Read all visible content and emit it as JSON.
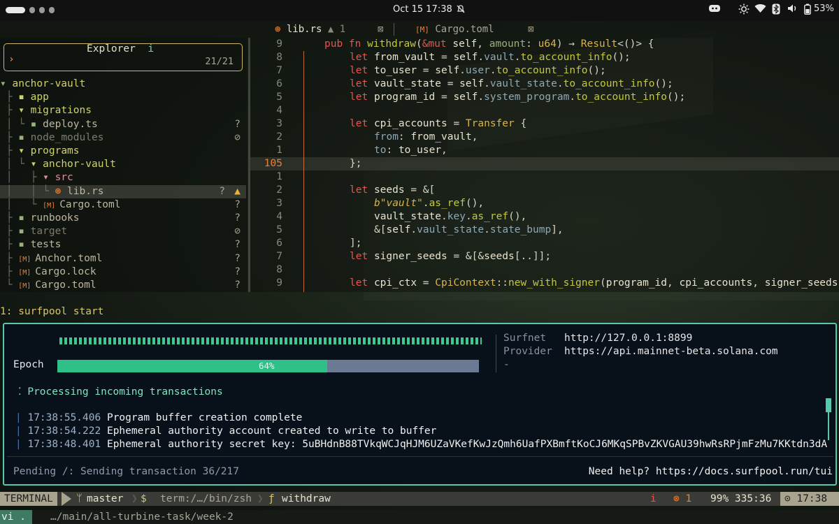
{
  "topbar": {
    "datetime": "Oct 15  17:38",
    "bell_icon": "bell-off-icon",
    "battery": "53%",
    "tray_icons": [
      "discord-icon",
      "brightness-icon",
      "wifi-icon",
      "bluetooth-icon",
      "volume-icon",
      "battery-icon"
    ]
  },
  "tabs": [
    {
      "icon": "⊛",
      "label": "lib.rs",
      "badge": "▲ 1",
      "close": "⊠"
    },
    {
      "icon": "[M]",
      "label": "Cargo.toml",
      "close": "⊠"
    }
  ],
  "explorer": {
    "title": "Explorer",
    "info": "i",
    "count": "21/21",
    "prompt": "›",
    "tree": [
      {
        "indent": "",
        "icon": "▾",
        "name": "anchor-vault",
        "kind": "root",
        "status": ""
      },
      {
        "indent": "├ ",
        "icon": "▪",
        "name": "app",
        "kind": "dir",
        "status": ""
      },
      {
        "indent": "├ ",
        "icon": "▾",
        "name": "migrations",
        "kind": "dir",
        "status": ""
      },
      {
        "indent": "│ └ ",
        "icon": "▪",
        "name": "deploy.ts",
        "kind": "file",
        "status": "?"
      },
      {
        "indent": "├ ",
        "icon": "▪",
        "name": "node_modules",
        "kind": "dim",
        "status": "⊘"
      },
      {
        "indent": "├ ",
        "icon": "▾",
        "name": "programs",
        "kind": "dir",
        "status": ""
      },
      {
        "indent": "│ └ ",
        "icon": "▾",
        "name": "anchor-vault",
        "kind": "dir",
        "status": ""
      },
      {
        "indent": "│   ├ ",
        "icon": "▾",
        "name": "src",
        "kind": "pink",
        "status": ""
      },
      {
        "indent": "│   │ └ ",
        "icon": "⊛",
        "name": "lib.rs",
        "kind": "selected",
        "status": "?",
        "warn": "▲"
      },
      {
        "indent": "│   └ ",
        "icon": "[M]",
        "name": "Cargo.toml",
        "kind": "file",
        "status": "?"
      },
      {
        "indent": "├ ",
        "icon": "▪",
        "name": "runbooks",
        "kind": "file",
        "status": "?"
      },
      {
        "indent": "├ ",
        "icon": "▪",
        "name": "target",
        "kind": "dim",
        "status": "⊘"
      },
      {
        "indent": "├ ",
        "icon": "▪",
        "name": "tests",
        "kind": "file",
        "status": "?"
      },
      {
        "indent": "├ ",
        "icon": "[M]",
        "name": "Anchor.toml",
        "kind": "file",
        "status": "?"
      },
      {
        "indent": "├ ",
        "icon": "[M]",
        "name": "Cargo.lock",
        "kind": "file",
        "status": "?"
      },
      {
        "indent": "└ ",
        "icon": "[M]",
        "name": "Cargo.toml",
        "kind": "file",
        "status": "?"
      }
    ]
  },
  "editor": {
    "line_numbers": [
      "9",
      "8",
      "7",
      "6",
      "5",
      "4",
      "3",
      "2",
      "1",
      "105",
      "1",
      "2",
      "3",
      "4",
      "5",
      "6",
      "7",
      "8",
      "9"
    ],
    "current_line_index": 9
  },
  "terminal": {
    "title": "1: surfpool start"
  },
  "surfpool": {
    "epoch_label": "Epoch",
    "epoch_progress": 0.64,
    "epoch_pct": "64%",
    "surfnet_label": "Surfnet",
    "surfnet_value": "http://127.0.0.1:8899",
    "provider_label": "Provider",
    "provider_value": "https://api.mainnet-beta.solana.com",
    "extra_value": "-",
    "processing": "⁚ Processing incoming transactions",
    "logs": [
      {
        "time": "17:38:55.406",
        "msg": "Program buffer creation complete"
      },
      {
        "time": "17:38:54.222",
        "msg": "Ephemeral authority account created to write to buffer"
      },
      {
        "time": "17:38:48.401",
        "msg": "Ephemeral authority secret key: 5uBHdnB88TVkqWCJqHJM6UZaVKefKwJzQmh6UafPXBmftKoCJ6MKqSPBvZKVGAU39hwRsRPjmFzMu7KKtdn3dA"
      }
    ],
    "pending": "Pending /: Sending transaction 36/217",
    "help": "Need help? https://docs.surfpool.run/tui"
  },
  "statusline": {
    "mode": "TERMINAL",
    "branch_icon": "git-branch-icon",
    "branch": "master",
    "dollar": "$",
    "term": "term:/…/bin/zsh",
    "fn_icon": "ƒ",
    "fn": "withdraw",
    "info": "i",
    "errors": "⊗ 1",
    "position": "99% 335:36",
    "clock_icon": "⊙",
    "time": "17:38"
  },
  "shell": {
    "mode": "vi .",
    "path": "…/main/all-turbine-task/week-2"
  },
  "colors": {
    "accent": "#58c9a8",
    "epoch_fill": "#2fbf88",
    "epoch_track": "#6b7a92",
    "keyword": "#e3564f",
    "function": "#c3c840"
  }
}
